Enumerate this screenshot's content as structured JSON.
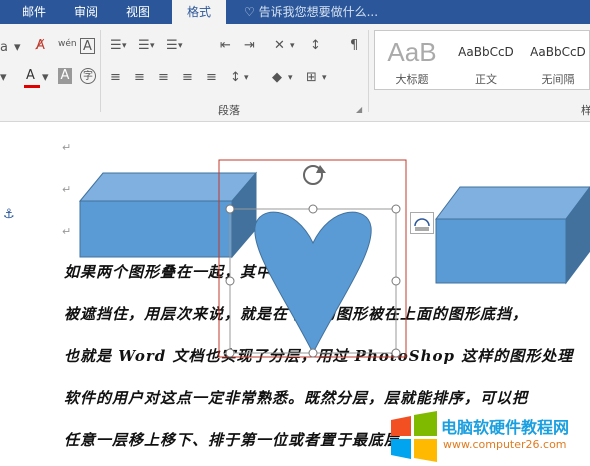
{
  "tabs": [
    {
      "label": "邮件"
    },
    {
      "label": "审阅"
    },
    {
      "label": "视图"
    },
    {
      "label": "格式",
      "active": true
    }
  ],
  "tell_me": {
    "text": "告诉我您想要做什么..."
  },
  "ribbon": {
    "paragraph_group_label": "段落",
    "styles": [
      {
        "preview": "AaB",
        "name": "大标题"
      },
      {
        "preview": "AaBbCcD",
        "name": "正文"
      },
      {
        "preview": "AaBbCcD",
        "name": "无间隔"
      }
    ],
    "next_group_partial": "样"
  },
  "document": {
    "lines": [
      "如果两个图形叠在一起，其中一个图形会",
      "被遮挡住，用层次来说，就是在下面的图形被在上面的图形底挡，",
      "也就是 Word 文档也实现了分层，用过 PhotoShop 这样的图形处理",
      "软件的用户对这点一定非常熟悉。既然分层，层就能排序，可以把",
      "任意一层移上移下、排于第一位或者置于最底层。"
    ],
    "shapes": [
      {
        "type": "cube",
        "color": "#5b9bd5"
      },
      {
        "type": "heart",
        "color": "#5b9bd5"
      },
      {
        "type": "cube",
        "color": "#5b9bd5"
      }
    ]
  },
  "watermark": {
    "title": "电脑软硬件教程网",
    "url": "www.computer26.com"
  },
  "colors": {
    "ribbon_blue": "#2b579a",
    "shape_fill": "#5b9bd5",
    "selection_red": "#c0392b"
  }
}
